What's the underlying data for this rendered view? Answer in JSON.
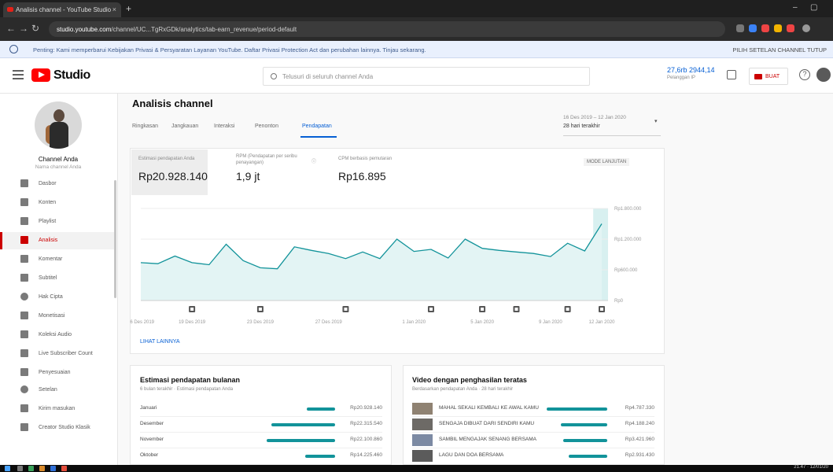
{
  "browser": {
    "tab_title": "Analisis channel - YouTube Studio",
    "tab_close": "×",
    "new_tab": "+",
    "url_domain": "studio.youtube.com",
    "url_path": "/channel/UC...TgRxGDk/analytics/tab-earn_revenue/period-default",
    "win_minimize": "–",
    "win_maximize": "▢"
  },
  "infobar": {
    "text": "Penting: Kami memperbarui Kebijakan Privasi & Persyaratan Layanan YouTube. Daftar Privasi Protection Act dan perubahan lainnya. Tinjau sekarang.",
    "action": "PILIH SETELAN CHANNEL   TUTUP"
  },
  "header": {
    "logo": "Studio",
    "search_placeholder": "Telusuri di seluruh channel Anda",
    "ip_value": "27,6rb  2944,14",
    "ip_sub": "Pelanggan   IP",
    "create_label": "BUAT",
    "help": "?"
  },
  "sidebar": {
    "channel_name": "Channel Anda",
    "channel_sub": "Nama channel Anda",
    "items": [
      {
        "label": "Dasbor",
        "active": false
      },
      {
        "label": "Konten",
        "active": false
      },
      {
        "label": "Playlist",
        "active": false
      },
      {
        "label": "Analisis",
        "active": true
      },
      {
        "label": "Komentar",
        "active": false
      },
      {
        "label": "Subtitel",
        "active": false
      },
      {
        "label": "Hak Cipta",
        "active": false
      },
      {
        "label": "Monetisasi",
        "active": false
      },
      {
        "label": "Koleksi Audio",
        "active": false
      },
      {
        "label": "Live Subscriber Count",
        "active": false
      },
      {
        "label": "Penyesuaian",
        "active": false
      },
      {
        "label": "Setelan",
        "active": false
      },
      {
        "label": "Kirim masukan",
        "active": false
      },
      {
        "label": "Creator Studio Klasik",
        "active": false
      }
    ]
  },
  "main": {
    "title": "Analisis channel",
    "tabs": [
      "Ringkasan",
      "Jangkauan",
      "Interaksi",
      "Penonton",
      "Pendapatan"
    ],
    "active_tab": "Pendapatan",
    "date_range": "16 Des 2019 – 12 Jan 2020",
    "date_select": "28 hari terakhir"
  },
  "metrics": [
    {
      "label": "Estimasi pendapatan Anda",
      "value": "Rp20.928.140"
    },
    {
      "label": "RPM (Pendapatan per seribu penayangan)",
      "value": "1,9 jt"
    },
    {
      "label": "CPM berbasis pemutaran",
      "value": "Rp16.895"
    }
  ],
  "advanced_mode": "MODE LANJUTAN",
  "see_more": "LIHAT LAINNYA",
  "chart_data": {
    "type": "area",
    "x": [
      "16 Des 2019",
      "17 Des",
      "18 Des",
      "19 Des",
      "20 Des",
      "21 Des",
      "22 Des",
      "23 Des",
      "24 Des",
      "25 Des",
      "26 Des",
      "27 Des",
      "28 Des",
      "29 Des",
      "30 Des",
      "31 Des",
      "1 Jan",
      "2 Jan",
      "3 Jan",
      "4 Jan",
      "5 Jan",
      "6 Jan",
      "7 Jan",
      "8 Jan",
      "9 Jan",
      "10 Jan",
      "11 Jan",
      "12 Jan"
    ],
    "values": [
      740000,
      720000,
      870000,
      740000,
      700000,
      1100000,
      780000,
      640000,
      620000,
      1050000,
      980000,
      920000,
      820000,
      950000,
      820000,
      1200000,
      960000,
      1000000,
      830000,
      1200000,
      1020000,
      980000,
      950000,
      920000,
      860000,
      1120000,
      970000,
      1500000
    ],
    "x_ticks": [
      "16 Des 2019",
      "19 Des 2019",
      "23 Des 2019",
      "27 Des 2019",
      "1 Jan 2020",
      "5 Jan 2020",
      "9 Jan 2020",
      "12 Jan 2020"
    ],
    "y_ticks": [
      "Rp0",
      "Rp600.000",
      "Rp1.200.000",
      "Rp1.800.000"
    ],
    "ylim": [
      0,
      1800000
    ],
    "grid": true,
    "line_color": "#12939a",
    "marker_positions": [
      3,
      7,
      12,
      17,
      20,
      22,
      25,
      27
    ]
  },
  "monthly": {
    "title": "Estimasi pendapatan bulanan",
    "subtitle": "6 bulan terakhir · Estimasi pendapatan Anda",
    "rows": [
      {
        "label": "Januari",
        "value": "Rp20.928.140",
        "frac": 0.26
      },
      {
        "label": "Desember",
        "value": "Rp22.315.540",
        "frac": 0.58
      },
      {
        "label": "November",
        "value": "Rp22.100.860",
        "frac": 0.62
      },
      {
        "label": "Oktober",
        "value": "Rp14.225.460",
        "frac": 0.27
      }
    ]
  },
  "top_videos": {
    "title": "Video dengan penghasilan teratas",
    "subtitle": "Berdasarkan pendapatan Anda · 28 hari terakhir",
    "rows": [
      {
        "label": "MAHAL SEKALI KEMBALI KE AWAL KAMU",
        "value": "Rp4.787.330",
        "frac": 0.55
      },
      {
        "label": "SENGAJA DIBUAT DARI SENDIRI KAMU",
        "value": "Rp4.188.240",
        "frac": 0.42
      },
      {
        "label": "SAMBIL MENGAJAK SENANG BERSAMA",
        "value": "Rp3.421.960",
        "frac": 0.4
      },
      {
        "label": "LAGU DAN DOA BERSAMA",
        "value": "Rp2.931.430",
        "frac": 0.35
      }
    ]
  },
  "taskbar": {
    "clock": "21.47 · 12/01/20"
  },
  "colors": {
    "accent": "#065fd4",
    "brand": "#ff0000",
    "chart": "#12939a",
    "active_nav": "#cc0000"
  }
}
